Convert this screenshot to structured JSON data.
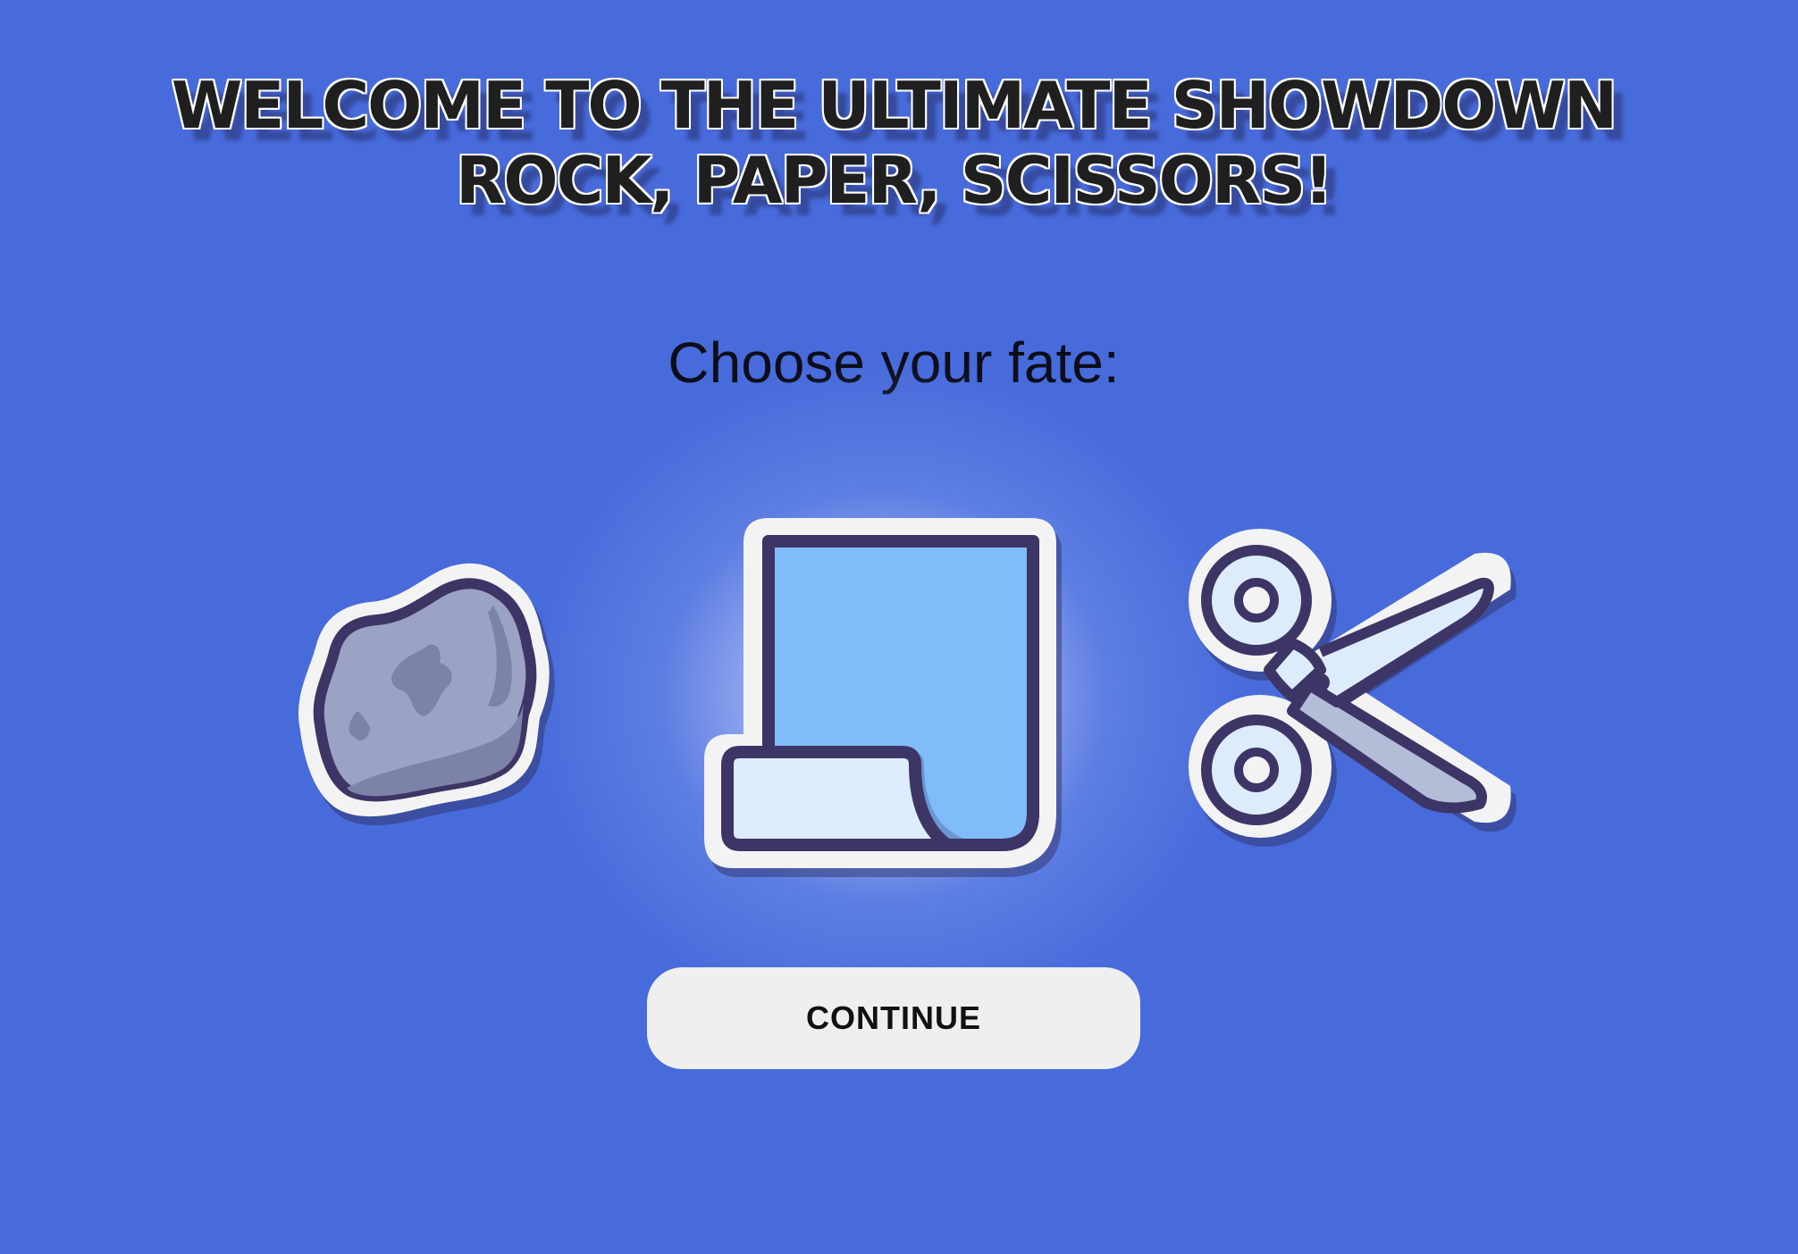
{
  "title": {
    "line1": "WELCOME TO THE ULTIMATE SHOWDOWN",
    "line2": "ROCK, PAPER, SCISSORS!"
  },
  "prompt": "Choose your fate:",
  "choices": [
    {
      "id": "rock",
      "icon": "rock-icon",
      "selected": false
    },
    {
      "id": "paper",
      "icon": "paper-icon",
      "selected": true
    },
    {
      "id": "scissors",
      "icon": "scissors-icon",
      "selected": false
    }
  ],
  "continue_button": {
    "label": "CONTINUE"
  },
  "colors": {
    "background": "#476bdb",
    "outline": "#3d3566",
    "rock": "#9aa3c4",
    "rock_shade": "#7d83a8",
    "paper": "#80bcfa",
    "paper_curl": "#ddedfb",
    "paper_shadow": "#6a97d0",
    "scissors_blade": "#b3bdd8",
    "scissors_blade_light": "#ddecfb",
    "sticker_border": "#f3f3f3",
    "button": "#efefef"
  }
}
